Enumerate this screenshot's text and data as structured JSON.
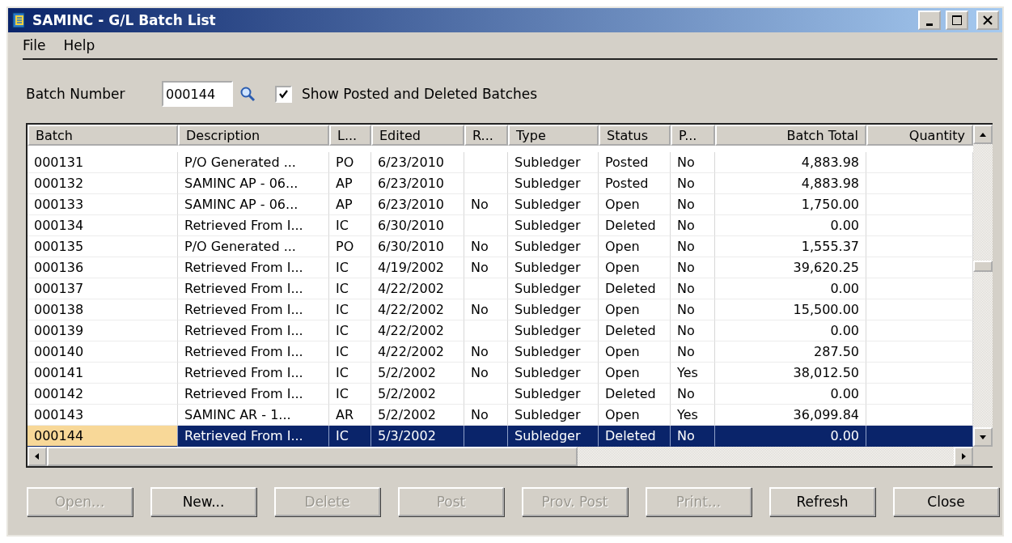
{
  "window": {
    "title": "SAMINC - G/L Batch List"
  },
  "menu": [
    "File",
    "Help"
  ],
  "filter": {
    "label": "Batch Number",
    "value": "000144",
    "show_posted": {
      "label": "Show Posted and Deleted Batches",
      "checked": true
    }
  },
  "table": {
    "columns": [
      "Batch",
      "Description",
      "L...",
      "Edited",
      "R...",
      "Type",
      "Status",
      "P...",
      "Batch Total",
      "Quantity"
    ],
    "rows": [
      {
        "selected": false,
        "cells": [
          "000131",
          "P/O Generated ...",
          "PO",
          "6/23/2010",
          "",
          "Subledger",
          "Posted",
          "No",
          "4,883.98",
          ""
        ]
      },
      {
        "selected": false,
        "cells": [
          "000132",
          "SAMINC AP - 06...",
          "AP",
          "6/23/2010",
          "",
          "Subledger",
          "Posted",
          "No",
          "4,883.98",
          ""
        ]
      },
      {
        "selected": false,
        "cells": [
          "000133",
          "SAMINC AP - 06...",
          "AP",
          "6/23/2010",
          "No",
          "Subledger",
          "Open",
          "No",
          "1,750.00",
          ""
        ]
      },
      {
        "selected": false,
        "cells": [
          "000134",
          "Retrieved From I...",
          "IC",
          "6/30/2010",
          "",
          "Subledger",
          "Deleted",
          "No",
          "0.00",
          ""
        ]
      },
      {
        "selected": false,
        "cells": [
          "000135",
          "P/O Generated ...",
          "PO",
          "6/30/2010",
          "No",
          "Subledger",
          "Open",
          "No",
          "1,555.37",
          ""
        ]
      },
      {
        "selected": false,
        "cells": [
          "000136",
          "Retrieved From I...",
          "IC",
          "4/19/2002",
          "No",
          "Subledger",
          "Open",
          "No",
          "39,620.25",
          ""
        ]
      },
      {
        "selected": false,
        "cells": [
          "000137",
          "Retrieved From I...",
          "IC",
          "4/22/2002",
          "",
          "Subledger",
          "Deleted",
          "No",
          "0.00",
          ""
        ]
      },
      {
        "selected": false,
        "cells": [
          "000138",
          "Retrieved From I...",
          "IC",
          "4/22/2002",
          "No",
          "Subledger",
          "Open",
          "No",
          "15,500.00",
          ""
        ]
      },
      {
        "selected": false,
        "cells": [
          "000139",
          "Retrieved From I...",
          "IC",
          "4/22/2002",
          "",
          "Subledger",
          "Deleted",
          "No",
          "0.00",
          ""
        ]
      },
      {
        "selected": false,
        "cells": [
          "000140",
          "Retrieved From I...",
          "IC",
          "4/22/2002",
          "No",
          "Subledger",
          "Open",
          "No",
          "287.50",
          ""
        ]
      },
      {
        "selected": false,
        "cells": [
          "000141",
          "Retrieved From I...",
          "IC",
          "5/2/2002",
          "No",
          "Subledger",
          "Open",
          "Yes",
          "38,012.50",
          ""
        ]
      },
      {
        "selected": false,
        "cells": [
          "000142",
          "Retrieved From I...",
          "IC",
          "5/2/2002",
          "",
          "Subledger",
          "Deleted",
          "No",
          "0.00",
          ""
        ]
      },
      {
        "selected": false,
        "cells": [
          "000143",
          "SAMINC AR - 1...",
          "AR",
          "5/2/2002",
          "No",
          "Subledger",
          "Open",
          "Yes",
          "36,099.84",
          ""
        ]
      },
      {
        "selected": true,
        "cells": [
          "000144",
          "Retrieved From I...",
          "IC",
          "5/3/2002",
          "",
          "Subledger",
          "Deleted",
          "No",
          "0.00",
          ""
        ]
      }
    ]
  },
  "buttons": [
    {
      "label": "Open...",
      "disabled": true
    },
    {
      "label": "New...",
      "disabled": false
    },
    {
      "label": "Delete",
      "disabled": true
    },
    {
      "label": "Post",
      "disabled": true
    },
    {
      "label": "Prov. Post",
      "disabled": true
    },
    {
      "label": "Print...",
      "disabled": true
    },
    {
      "label": "Refresh",
      "disabled": false
    },
    {
      "label": "Close",
      "disabled": false
    }
  ]
}
